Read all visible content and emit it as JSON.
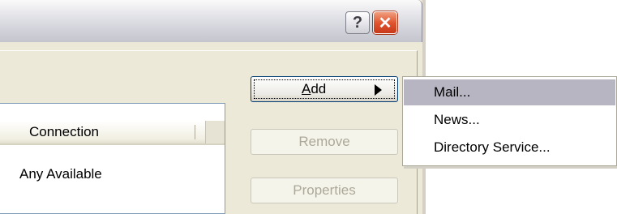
{
  "titlebar": {
    "help_icon": "question-mark-icon",
    "help_glyph": "?",
    "close_icon": "close-x-icon",
    "close_glyph": "✕"
  },
  "list": {
    "columns": [
      "Connection"
    ],
    "rows": [
      [
        "Any Available"
      ]
    ]
  },
  "buttons": {
    "add_pre": "",
    "add_mnemonic": "A",
    "add_post": "dd",
    "remove": "Remove",
    "properties": "Properties"
  },
  "menu": {
    "items": [
      {
        "label": "Mail...",
        "selected": true
      },
      {
        "label": "News...",
        "selected": false
      },
      {
        "label": "Directory Service...",
        "selected": false
      }
    ]
  },
  "colors": {
    "window_bg": "#ece9d8",
    "menu_highlight": "#b7b5c1",
    "close_red": "#e0562f"
  }
}
